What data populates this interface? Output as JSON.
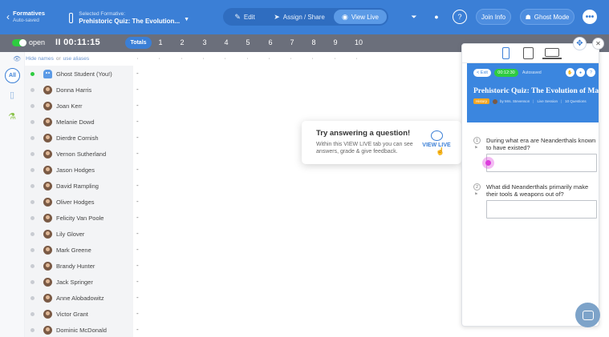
{
  "header": {
    "back_title": "Formatives",
    "back_sub": "Auto-saved",
    "selected_label": "Selected Formative:",
    "selected_title": "Prehistoric Quiz: The Evolution...",
    "modes": [
      {
        "label": "Edit",
        "icon": "✎"
      },
      {
        "label": "Assign / Share",
        "icon": "➤"
      },
      {
        "label": "View Live",
        "icon": "◉"
      }
    ],
    "join_info": "Join Info",
    "ghost_mode": "Ghost Mode",
    "more": "•••"
  },
  "subbar": {
    "open_label": "open",
    "timer": "00:11:15",
    "pause_icon": "II",
    "totals": "Totals",
    "question_numbers": [
      "1",
      "2",
      "3",
      "4",
      "5",
      "6",
      "7",
      "8",
      "9",
      "10"
    ]
  },
  "names_options": {
    "hide": "Hide names",
    "or": "or",
    "alias": "use aliases"
  },
  "rail": {
    "all": "All"
  },
  "students": [
    {
      "name": "Ghost Student (You!)",
      "online": true,
      "ghost": true
    },
    {
      "name": "Donna Harris",
      "online": false
    },
    {
      "name": "Joan Kerr",
      "online": false
    },
    {
      "name": "Melanie Dowd",
      "online": false
    },
    {
      "name": "Dierdre Cornish",
      "online": false
    },
    {
      "name": "Vernon Sutherland",
      "online": false
    },
    {
      "name": "Jason Hodges",
      "online": false
    },
    {
      "name": "David Rampling",
      "online": false
    },
    {
      "name": "Oliver Hodges",
      "online": false
    },
    {
      "name": "Felicity Van Poole",
      "online": false
    },
    {
      "name": "Lily Glover",
      "online": false
    },
    {
      "name": "Mark Greene",
      "online": false
    },
    {
      "name": "Brandy Hunter",
      "online": false
    },
    {
      "name": "Jack Springer",
      "online": false
    },
    {
      "name": "Anne Alobadowitz",
      "online": false
    },
    {
      "name": "Victor Grant",
      "online": false
    },
    {
      "name": "Dominic McDonald",
      "online": false
    }
  ],
  "dash": "-",
  "tooltip": {
    "title": "Try answering a question!",
    "body": "Within this VIEW LIVE tab you can see answers, grade & give feedback.",
    "button": "VIEW LIVE"
  },
  "preview": {
    "exit": "< Exit",
    "timer": "00:12:30",
    "sub": "Autosaved",
    "title": "Prehistoric Quiz: The Evolution of Man",
    "tag": "History",
    "author": "by Mrs. Stevenson",
    "session": "Live Session",
    "count": "10 Questions",
    "questions": [
      {
        "num": "1",
        "text": "During what era are Neanderthals known to have existed?"
      },
      {
        "num": "2",
        "text": "What did Neanderthals primarily make their tools & weapons out of?"
      }
    ]
  },
  "colors": {
    "primary": "#3b7fd6",
    "online": "#2ecc40",
    "subbar": "#6b6f7b",
    "highlight": "#dd3cdd"
  }
}
